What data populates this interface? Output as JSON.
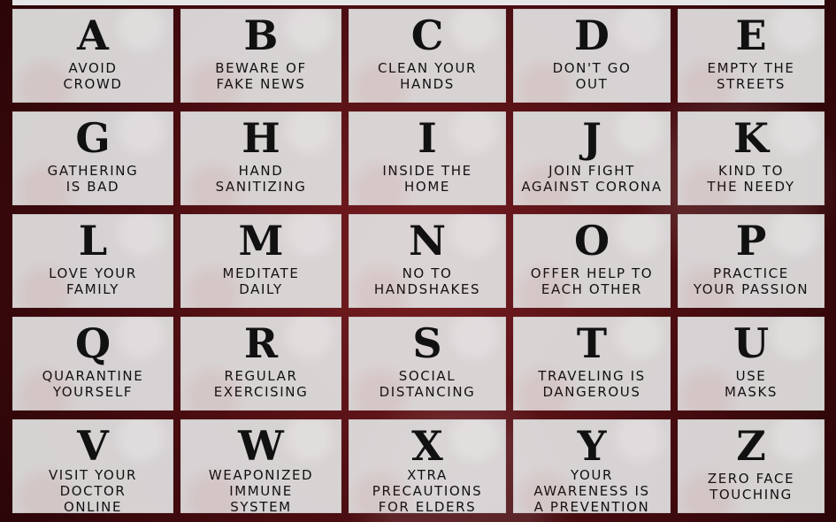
{
  "tiles": [
    {
      "letter": "A",
      "lines": [
        "AVOID",
        "CROWD"
      ]
    },
    {
      "letter": "B",
      "lines": [
        "BEWARE OF",
        "FAKE NEWS"
      ]
    },
    {
      "letter": "C",
      "lines": [
        "CLEAN YOUR",
        "HANDS"
      ]
    },
    {
      "letter": "D",
      "lines": [
        "DON'T GO",
        "OUT"
      ]
    },
    {
      "letter": "E",
      "lines": [
        "EMPTY THE",
        "STREETS"
      ]
    },
    {
      "letter": "G",
      "lines": [
        "GATHERING",
        "IS BAD"
      ]
    },
    {
      "letter": "H",
      "lines": [
        "HAND",
        "SANITIZING"
      ]
    },
    {
      "letter": "I",
      "lines": [
        "INSIDE THE",
        "HOME"
      ]
    },
    {
      "letter": "J",
      "lines": [
        "JOIN FIGHT",
        "AGAINST CORONA"
      ]
    },
    {
      "letter": "K",
      "lines": [
        "KIND TO",
        "THE NEEDY"
      ]
    },
    {
      "letter": "L",
      "lines": [
        "LOVE YOUR",
        "FAMILY"
      ]
    },
    {
      "letter": "M",
      "lines": [
        "MEDITATE",
        "DAILY"
      ]
    },
    {
      "letter": "N",
      "lines": [
        "NO TO",
        "HANDSHAKES"
      ]
    },
    {
      "letter": "O",
      "lines": [
        "OFFER HELP TO",
        "EACH OTHER"
      ]
    },
    {
      "letter": "P",
      "lines": [
        "PRACTICE",
        "YOUR PASSION"
      ]
    },
    {
      "letter": "Q",
      "lines": [
        "QUARANTINE",
        "YOURSELF"
      ]
    },
    {
      "letter": "R",
      "lines": [
        "REGULAR",
        "EXERCISING"
      ]
    },
    {
      "letter": "S",
      "lines": [
        "SOCIAL",
        "DISTANCING"
      ]
    },
    {
      "letter": "T",
      "lines": [
        "TRAVELING IS",
        "DANGEROUS"
      ]
    },
    {
      "letter": "U",
      "lines": [
        "USE",
        "MASKS"
      ]
    },
    {
      "letter": "V",
      "lines": [
        "VISIT YOUR",
        "DOCTOR",
        "ONLINE"
      ]
    },
    {
      "letter": "W",
      "lines": [
        "WEAPONIZED",
        "IMMUNE",
        "SYSTEM"
      ]
    },
    {
      "letter": "X",
      "lines": [
        "XTRA",
        "PRECAUTIONS",
        "FOR ELDERS"
      ]
    },
    {
      "letter": "Y",
      "lines": [
        "YOUR",
        "AWARENESS IS",
        "A PREVENTION"
      ]
    },
    {
      "letter": "Z",
      "lines": [
        "ZERO FACE",
        "TOUCHING"
      ]
    }
  ]
}
